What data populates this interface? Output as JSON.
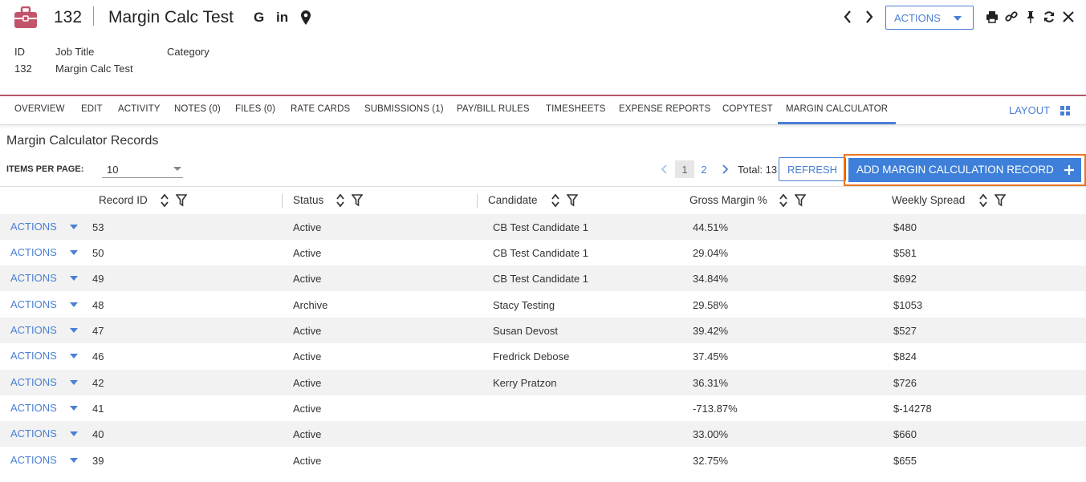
{
  "header": {
    "record_id": "132",
    "title": "Margin Calc Test",
    "social_g": "G",
    "social_in": "in",
    "actions_label": "ACTIONS",
    "brand_color": "#c1536a"
  },
  "meta": {
    "labels": {
      "id": "ID",
      "job_title": "Job Title",
      "category": "Category"
    },
    "values": {
      "id": "132",
      "job_title": "Margin Calc Test",
      "category": ""
    }
  },
  "tabs": [
    {
      "label": "OVERVIEW"
    },
    {
      "label": "EDIT"
    },
    {
      "label": "ACTIVITY"
    },
    {
      "label": "NOTES (0)"
    },
    {
      "label": "FILES (0)"
    },
    {
      "label": "RATE CARDS"
    },
    {
      "label": "SUBMISSIONS (1)"
    },
    {
      "label": "PAY/BILL RULES"
    },
    {
      "label": "TIMESHEETS"
    },
    {
      "label": "EXPENSE REPORTS"
    },
    {
      "label": "COPYTEST"
    },
    {
      "label": "MARGIN CALCULATOR",
      "active": true
    }
  ],
  "layout_label": "LAYOUT",
  "section": {
    "title": "Margin Calculator Records",
    "items_per_page_label": "ITEMS PER PAGE:",
    "items_per_page_value": "10",
    "pages": [
      "1",
      "2"
    ],
    "current_page": "1",
    "total_label": "Total: 13",
    "refresh_label": "REFRESH",
    "add_label": "ADD MARGIN CALCULATION RECORD"
  },
  "table": {
    "columns": [
      "Record ID",
      "Status",
      "Candidate",
      "Gross Margin %",
      "Weekly Spread"
    ],
    "row_action_label": "ACTIONS",
    "rows": [
      {
        "id": "53",
        "status": "Active",
        "candidate": "CB Test Candidate 1",
        "margin": "44.51%",
        "spread": "$480"
      },
      {
        "id": "50",
        "status": "Active",
        "candidate": "CB Test Candidate 1",
        "margin": "29.04%",
        "spread": "$581"
      },
      {
        "id": "49",
        "status": "Active",
        "candidate": "CB Test Candidate 1",
        "margin": "34.84%",
        "spread": "$692"
      },
      {
        "id": "48",
        "status": "Archive",
        "candidate": "Stacy Testing",
        "margin": "29.58%",
        "spread": "$1053"
      },
      {
        "id": "47",
        "status": "Active",
        "candidate": "Susan Devost",
        "margin": "39.42%",
        "spread": "$527"
      },
      {
        "id": "46",
        "status": "Active",
        "candidate": "Fredrick Debose",
        "margin": "37.45%",
        "spread": "$824"
      },
      {
        "id": "42",
        "status": "Active",
        "candidate": "Kerry Pratzon",
        "margin": "36.31%",
        "spread": "$726"
      },
      {
        "id": "41",
        "status": "Active",
        "candidate": "",
        "margin": "-713.87%",
        "spread": "$-14278"
      },
      {
        "id": "40",
        "status": "Active",
        "candidate": "",
        "margin": "33.00%",
        "spread": "$660"
      },
      {
        "id": "39",
        "status": "Active",
        "candidate": "",
        "margin": "32.75%",
        "spread": "$655"
      }
    ]
  }
}
